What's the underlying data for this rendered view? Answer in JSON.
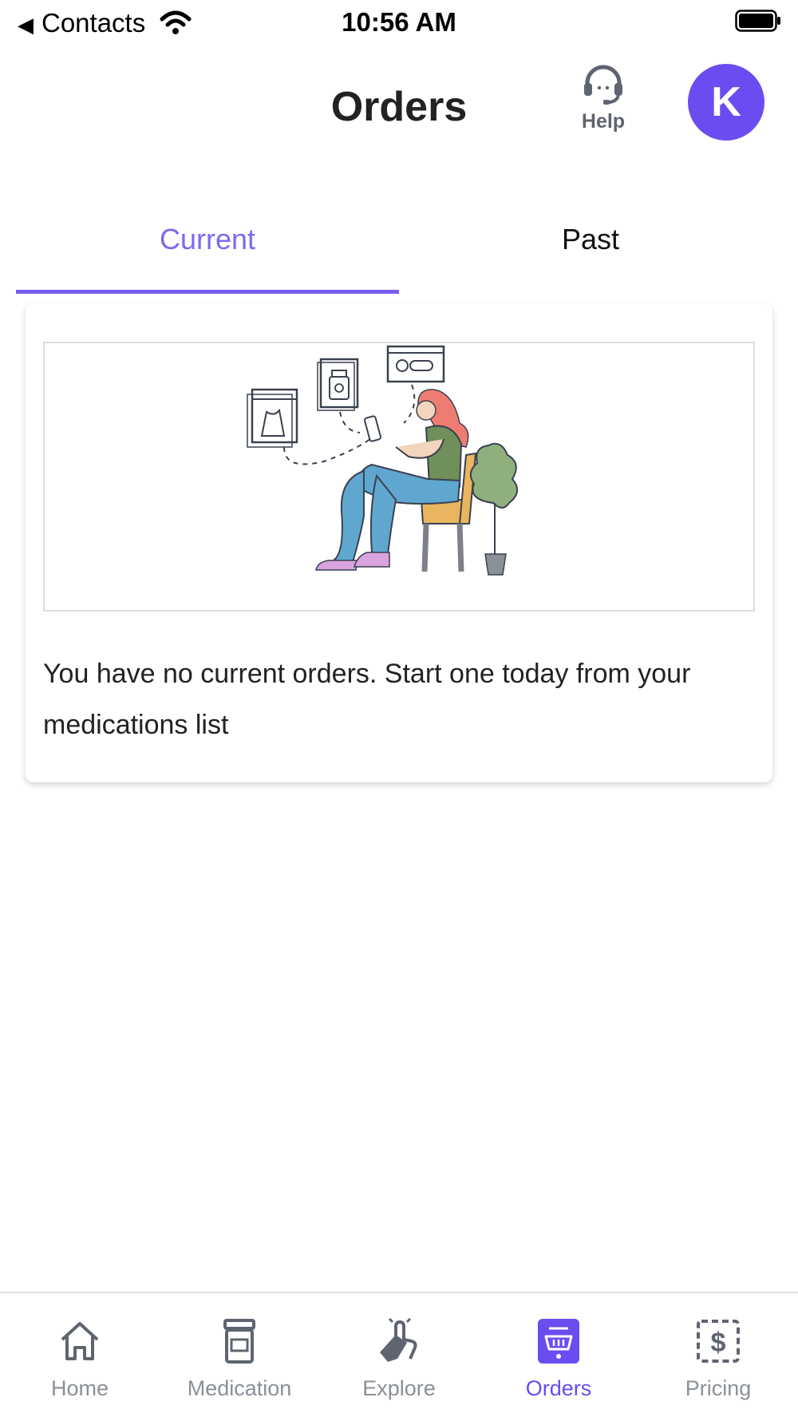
{
  "status_bar": {
    "back_app": "Contacts",
    "time": "10:56 AM"
  },
  "header": {
    "title": "Orders",
    "help_label": "Help",
    "avatar_initial": "K"
  },
  "tabs": [
    {
      "label": "Current",
      "active": true
    },
    {
      "label": "Past",
      "active": false
    }
  ],
  "card": {
    "message": "You have no current orders. Start one today from your medications list"
  },
  "bottom_nav": [
    {
      "label": "Home",
      "icon": "home-icon",
      "active": false
    },
    {
      "label": "Medication",
      "icon": "pill-bottle-icon",
      "active": false
    },
    {
      "label": "Explore",
      "icon": "hand-tap-icon",
      "active": false
    },
    {
      "label": "Orders",
      "icon": "basket-icon",
      "active": true
    },
    {
      "label": "Pricing",
      "icon": "dollar-tag-icon",
      "active": false
    }
  ],
  "colors": {
    "accent": "#6b4cf0",
    "tab_active_text": "#7a6af0",
    "inactive": "#8a8f98"
  }
}
